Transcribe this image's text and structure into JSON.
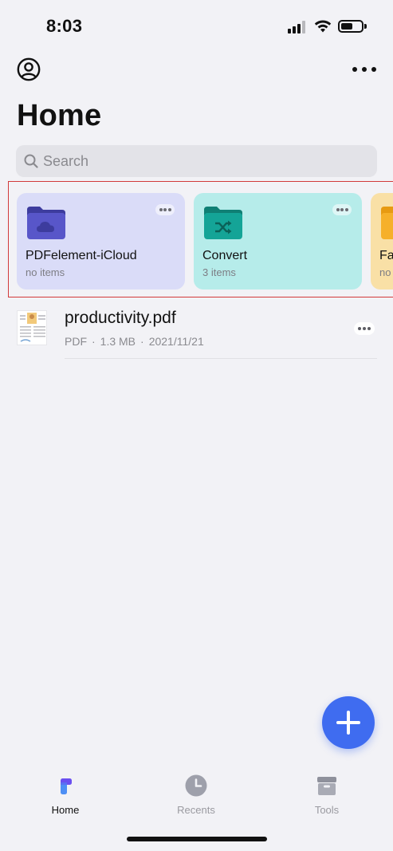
{
  "status_bar": {
    "time": "8:03"
  },
  "header": {
    "title": "Home"
  },
  "search": {
    "placeholder": "Search"
  },
  "folders": [
    {
      "name": "PDFelement-iCloud",
      "count": "no items",
      "color": "#dadcf8",
      "icon": "cloud-folder-icon"
    },
    {
      "name": "Convert",
      "count": "3 items",
      "color": "#b6ecea",
      "icon": "convert-folder-icon"
    },
    {
      "name": "Fa",
      "count": "no",
      "color": "#f9e0a6",
      "icon": "folder-icon"
    }
  ],
  "files": [
    {
      "name": "productivity.pdf",
      "type": "PDF",
      "size": "1.3 MB",
      "date": "2021/11/21"
    }
  ],
  "meta_separator": "·",
  "tabs": [
    {
      "label": "Home",
      "icon": "home-icon",
      "active": true
    },
    {
      "label": "Recents",
      "icon": "clock-icon",
      "active": false
    },
    {
      "label": "Tools",
      "icon": "toolbox-icon",
      "active": false
    }
  ],
  "colors": {
    "accent": "#3f6cf0",
    "background": "#f2f2f6"
  }
}
